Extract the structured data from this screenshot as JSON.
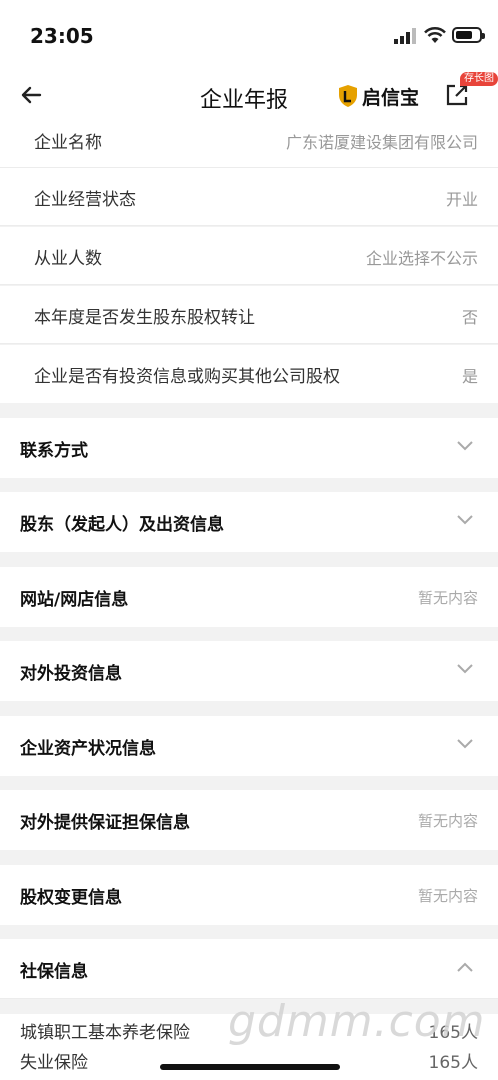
{
  "status": {
    "time": "23:05"
  },
  "nav": {
    "title": "企业年报",
    "brand": "启信宝",
    "badge": "存长图"
  },
  "info_rows": [
    {
      "label": "企业名称",
      "value": "广东诺厦建设集团有限公司"
    },
    {
      "label": "企业经营状态",
      "value": "开业"
    },
    {
      "label": "从业人数",
      "value": "企业选择不公示"
    },
    {
      "label": "本年度是否发生股东股权转让",
      "value": "否"
    },
    {
      "label": "企业是否有投资信息或购买其他公司股权",
      "value": "是"
    }
  ],
  "sections": [
    {
      "title": "联系方式",
      "right": "",
      "icon": "chevron-down-icon"
    },
    {
      "title": "股东（发起人）及出资信息",
      "right": "",
      "icon": "chevron-down-icon"
    },
    {
      "title": "网站/网店信息",
      "right": "暂无内容",
      "icon": ""
    },
    {
      "title": "对外投资信息",
      "right": "",
      "icon": "chevron-down-icon"
    },
    {
      "title": "企业资产状况信息",
      "right": "",
      "icon": "chevron-down-icon"
    },
    {
      "title": "对外提供保证担保信息",
      "right": "暂无内容",
      "icon": ""
    },
    {
      "title": "股权变更信息",
      "right": "暂无内容",
      "icon": ""
    },
    {
      "title": "社保信息",
      "right": "",
      "icon": "chevron-up-icon"
    }
  ],
  "social_insurance": [
    {
      "label": "城镇职工基本养老保险",
      "value": "165人"
    },
    {
      "label": "失业保险",
      "value": "165人"
    }
  ],
  "watermark": "gdmm.com",
  "colors": {
    "badge": "#e8443a",
    "brand_shield": "#e6a100"
  }
}
